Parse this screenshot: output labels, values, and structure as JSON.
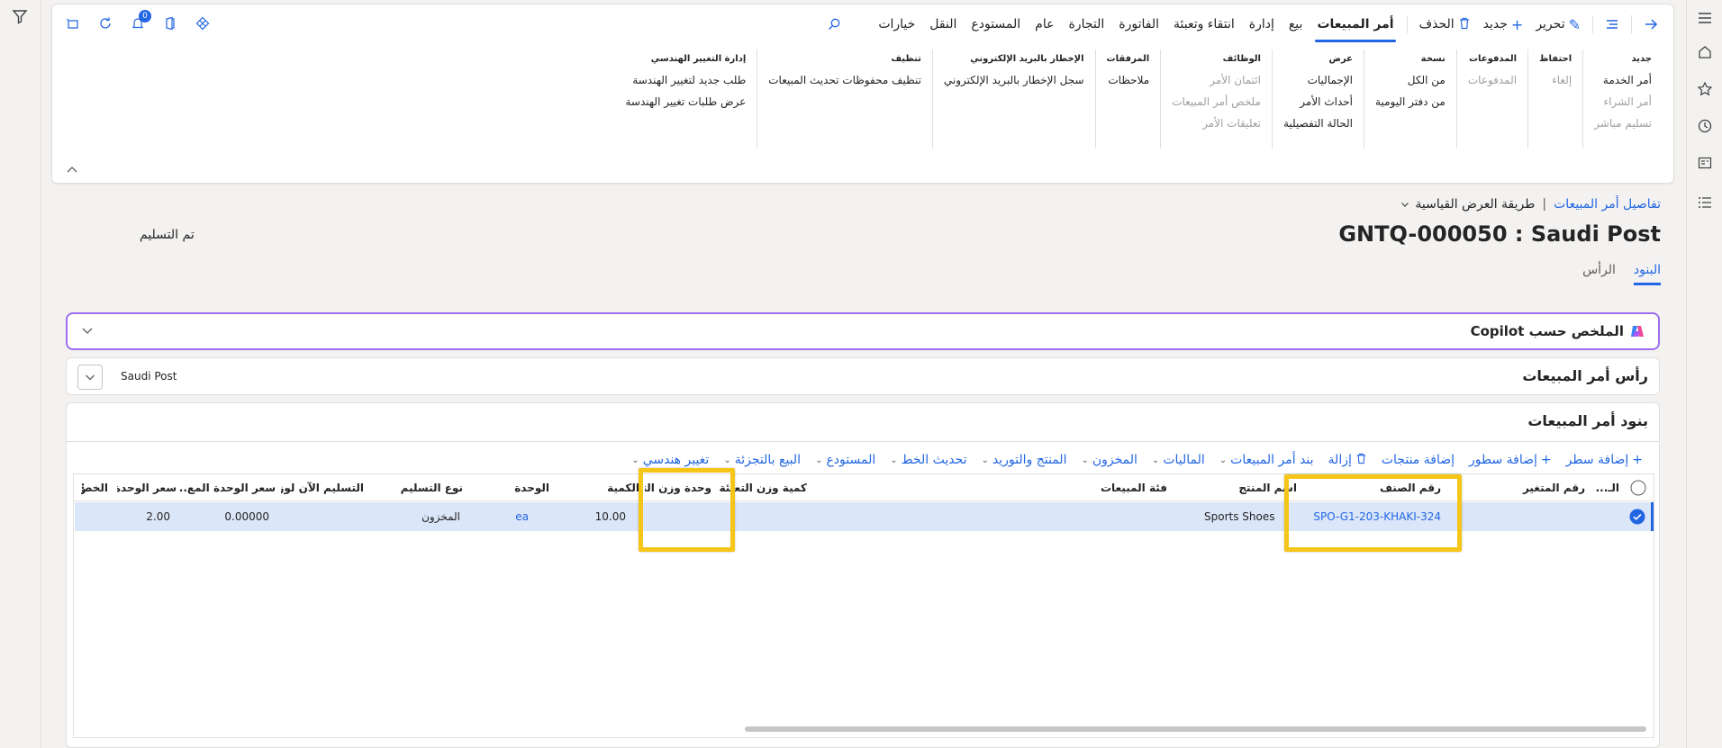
{
  "toolbar": {
    "edit_label": "تحرير",
    "new_label": "جديد",
    "delete_label": "الحذف",
    "tabs": [
      "أمر المبيعات",
      "بيع",
      "إدارة",
      "انتقاء وتعبئة",
      "الفاتورة",
      "التجارة",
      "عام",
      "المستودع",
      "النقل",
      "خيارات"
    ],
    "notification_count": "0"
  },
  "ribbon": {
    "groups": [
      {
        "title": "جديد",
        "items": [
          {
            "label": "أمر الخدمة",
            "disabled": false
          },
          {
            "label": "أمر الشراء",
            "disabled": true
          },
          {
            "label": "تسليم مباشر",
            "disabled": true
          }
        ]
      },
      {
        "title": "احتفاظ",
        "items": [
          {
            "label": "إلغاء",
            "disabled": true
          }
        ]
      },
      {
        "title": "المدفوعات",
        "items": [
          {
            "label": "المدفوعات",
            "disabled": true
          }
        ]
      },
      {
        "title": "نسخة",
        "items": [
          {
            "label": "من الكل",
            "disabled": false
          },
          {
            "label": "من دفتر اليومية",
            "disabled": false
          }
        ]
      },
      {
        "title": "عرض",
        "items": [
          {
            "label": "الإجماليات",
            "disabled": false
          },
          {
            "label": "أحداث الأمر",
            "disabled": false
          },
          {
            "label": "الحالة التفصيلية",
            "disabled": false
          }
        ]
      },
      {
        "title": "الوظائف",
        "items": [
          {
            "label": "ائتمان الأمر",
            "disabled": true
          },
          {
            "label": "ملخص أمر المبيعات",
            "disabled": true
          },
          {
            "label": "تعليقات الأمر",
            "disabled": true
          }
        ]
      },
      {
        "title": "المرفقات",
        "items": [
          {
            "label": "ملاحظات",
            "disabled": false
          }
        ]
      },
      {
        "title": "الإخطار بالبريد الإلكتروني",
        "items": [
          {
            "label": "سجل الإخطار بالبريد الإلكتروني",
            "disabled": false
          }
        ]
      },
      {
        "title": "تنظيف",
        "items": [
          {
            "label": "تنظيف محفوظات تحديث المبيعات",
            "disabled": false
          }
        ]
      },
      {
        "title": "إدارة التغيير الهندسي",
        "items": [
          {
            "label": "طلب جديد لتغيير الهندسة",
            "disabled": false
          },
          {
            "label": "عرض طلبات تغيير الهندسة",
            "disabled": false
          }
        ]
      }
    ]
  },
  "page": {
    "breadcrumb_link": "تفاصيل أمر المبيعات",
    "breadcrumb_sep": "|",
    "view_label": "طريقة العرض القياسية",
    "title": "GNTQ-000050 : Saudi Post",
    "status": "تم التسليم",
    "tabs": [
      "البنود",
      "الرأس"
    ]
  },
  "copilot": {
    "title": "الملخص حسب Copilot"
  },
  "header_tab": {
    "title": "رأس أمر المبيعات",
    "summary": "Saudi Post"
  },
  "lines": {
    "title": "بنود أمر المبيعات",
    "toolbar": [
      {
        "label": "إضافة سطر",
        "icon": "plus-icon",
        "dropdown": false
      },
      {
        "label": "إضافة سطور",
        "icon": "plus-multiple-icon",
        "dropdown": false
      },
      {
        "label": "إضافة منتجات",
        "icon": "",
        "dropdown": false
      },
      {
        "label": "إزالة",
        "icon": "trash-icon",
        "dropdown": false
      },
      {
        "label": "بند أمر المبيعات",
        "icon": "",
        "dropdown": true
      },
      {
        "label": "الماليات",
        "icon": "",
        "dropdown": true
      },
      {
        "label": "المخزون",
        "icon": "",
        "dropdown": true
      },
      {
        "label": "المنتج والتوريد",
        "icon": "",
        "dropdown": true
      },
      {
        "label": "تحديث الخط",
        "icon": "",
        "dropdown": true
      },
      {
        "label": "المستودع",
        "icon": "",
        "dropdown": true
      },
      {
        "label": "البيع بالتجزئة",
        "icon": "",
        "dropdown": true
      },
      {
        "label": "تغيير هندسي",
        "icon": "",
        "dropdown": true
      }
    ],
    "columns": {
      "line_flag": "الـ...",
      "variant": "رقم المتغير",
      "item_number": "رقم الصنف",
      "product_name": "اسم المنتج",
      "sales_category": "فئة المبيعات",
      "pack_qty": "كمية وزن التعبئة",
      "pack_unit": "وحدة وزن التعبئة",
      "quantity": "الكمية",
      "unit": "الوحدة",
      "delivery_type": "نوع التسليم",
      "cw_delivery": "التسليم الآن لوز...",
      "cw_unit_price": "سعر الوحدة المع...",
      "unit_price": "سعر الوحدة",
      "discount": "الخص"
    },
    "row": {
      "item_number": "SPO-G1-203-KHAKI-324",
      "product_name": "Sports Shoes",
      "quantity": "10.00",
      "unit": "ea",
      "delivery_type": "المخزون",
      "cw_unit_price": "0.00000",
      "unit_price": "2.00"
    }
  },
  "colors": {
    "accent": "#2266e3",
    "highlight": "#f5c518",
    "copilot_border": "#9b6ff0",
    "row_selected": "#dbe6f9"
  }
}
